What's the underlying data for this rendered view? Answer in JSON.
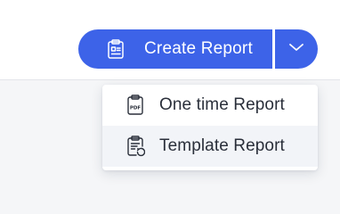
{
  "header": {
    "create_button": {
      "label": "Create Report",
      "icon": "report-clipboard-icon",
      "color": "#3d63e8",
      "text_color": "#ffffff"
    },
    "dropdown_toggle": {
      "icon": "chevron-down-icon"
    }
  },
  "menu": {
    "items": [
      {
        "label": "One time Report",
        "icon": "pdf-file-icon",
        "hovered": false
      },
      {
        "label": "Template Report",
        "icon": "template-clipboard-icon",
        "hovered": true
      }
    ]
  }
}
